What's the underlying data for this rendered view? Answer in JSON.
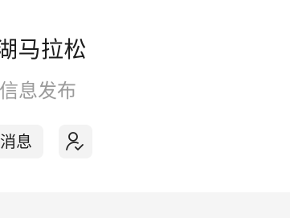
{
  "header": {
    "title": "湖马拉松",
    "subtitle": "信息发布"
  },
  "actions": {
    "message_label": "消息",
    "follow_icon": "user-check-icon"
  },
  "colors": {
    "title": "#1c1c1c",
    "subtitle": "#9a9a9a",
    "button_bg": "#f3f3f3",
    "footer_bg": "#f5f5f5"
  }
}
